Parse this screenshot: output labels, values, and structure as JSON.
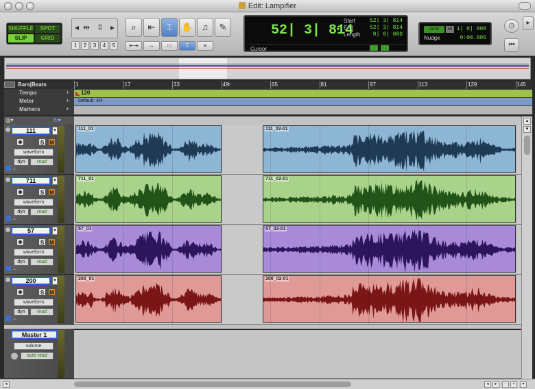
{
  "window": {
    "title": "Edit: Lampifier"
  },
  "modes": {
    "shuffle": "SHUFFLE",
    "spot": "SPOT",
    "slip": "SLIP",
    "grid": "GRID"
  },
  "zoom_presets": [
    "1",
    "2",
    "3",
    "4",
    "5"
  ],
  "counter": {
    "main": "52| 3| 814",
    "start_label": "Start",
    "start_value": "52| 3| 814",
    "end_label": "End",
    "end_value": "52| 3| 814",
    "length_label": "Length",
    "length_value": "0| 0| 000",
    "cursor_label": "Cursor"
  },
  "grid": {
    "label": "Grid",
    "value": "1| 0| 000",
    "nudge_label": "Nudge",
    "nudge_value": "0:00.005"
  },
  "rulers": {
    "bars_label": "Bars|Beats",
    "tempo_label": "Tempo",
    "tempo_value": "120",
    "meter_label": "Meter",
    "meter_value": "Default: 4/4",
    "markers_label": "Markers",
    "ticks": [
      "1",
      "17",
      "33",
      "49",
      "65",
      "81",
      "97",
      "113",
      "129",
      "145"
    ]
  },
  "tracks": [
    {
      "name": "111",
      "view": "waveform",
      "dyn": "dyn",
      "auto": "read",
      "color": "#8db6d4",
      "wave": "#1f3a55",
      "clip1": "111_01",
      "clip2": "111_02-01"
    },
    {
      "name": "711",
      "view": "waveform",
      "dyn": "dyn",
      "auto": "read",
      "color": "#a9d38a",
      "wave": "#22541a",
      "clip1": "711_01",
      "clip2": "711_02-01"
    },
    {
      "name": "57",
      "view": "waveform",
      "dyn": "dyn",
      "auto": "read",
      "color": "#a88ad8",
      "wave": "#2c155c",
      "clip1": "57_01",
      "clip2": "57_02-01"
    },
    {
      "name": "200",
      "view": "waveform",
      "dyn": "dyn",
      "auto": "read",
      "color": "#df9a97",
      "wave": "#7a1616",
      "clip1": "200_01",
      "clip2": "200_02-01"
    }
  ],
  "master": {
    "name": "Master 1",
    "view": "volume",
    "auto": "auto read"
  },
  "track_buttons": {
    "solo": "S",
    "mute": "M"
  }
}
